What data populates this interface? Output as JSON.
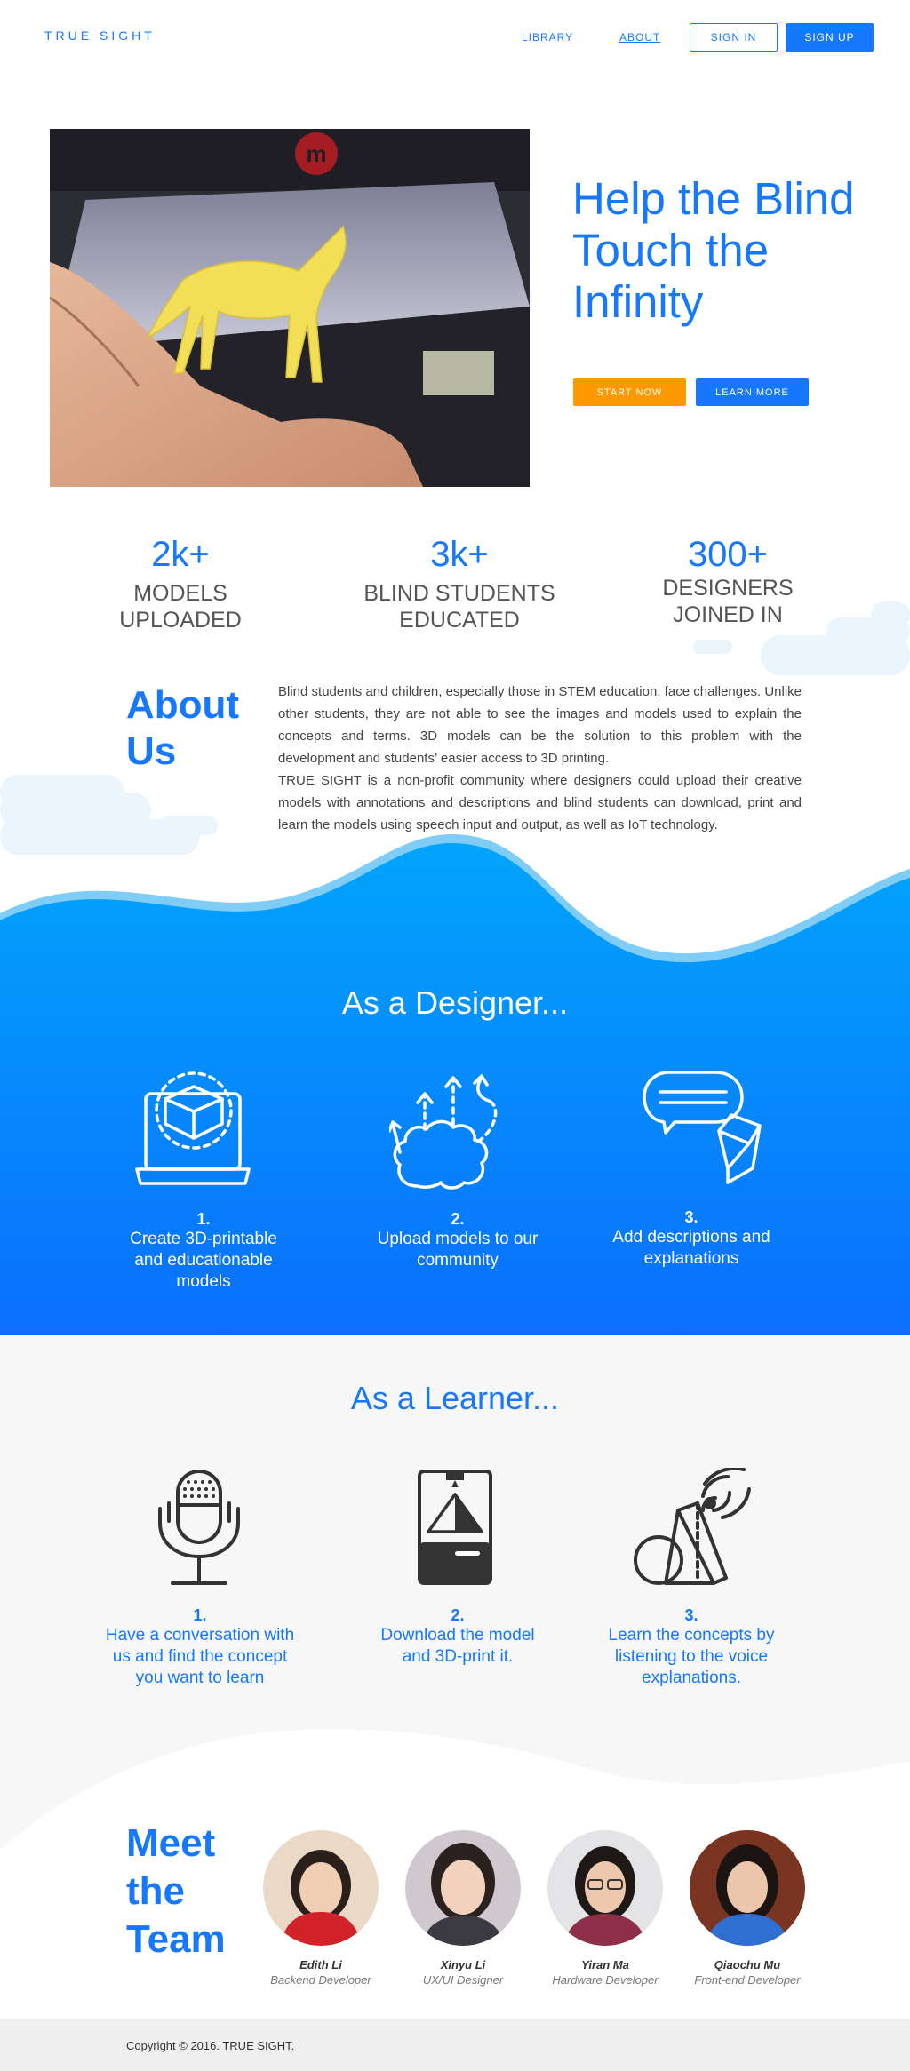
{
  "nav": {
    "brand": "TRUE SIGHT",
    "links": [
      "LIBRARY",
      "ABOUT"
    ],
    "sign_in": "SIGN IN",
    "sign_up": "SIGN UP"
  },
  "hero": {
    "title": "Help the Blind Touch the Infinity",
    "start_now": "START NOW",
    "learn_more": "LEARN MORE",
    "image": "3d-printed-horse-photo"
  },
  "stats": [
    {
      "number": "2k+",
      "label": "MODELS UPLOADED"
    },
    {
      "number": "3k+",
      "label": "BLIND STUDENTS EDUCATED"
    },
    {
      "number": "300+",
      "label": "DESIGNERS JOINED IN"
    }
  ],
  "about": {
    "title": "About Us",
    "paragraph1": "Blind students and children, especially those in STEM education, face challenges. Unlike other students, they are not able to see the images and models used to explain the concepts and terms. 3D models can be the solution to this problem with the development and students’ easier access to 3D printing.",
    "paragraph2": "TRUE SIGHT is a non-profit community where designers could upload their creative models with annotations and descriptions and blind students can download, print and learn the models using speech input and output, as well as IoT technology."
  },
  "designer": {
    "title": "As a Designer...",
    "steps": [
      {
        "num": "1.",
        "text": "Create 3D-printable and educationable models",
        "icon": "laptop-cube-icon"
      },
      {
        "num": "2.",
        "text": "Upload models to our community",
        "icon": "brain-upload-icon"
      },
      {
        "num": "3.",
        "text": "Add descriptions and explanations",
        "icon": "chat-cube-icon"
      }
    ]
  },
  "learner": {
    "title": "As a Learner...",
    "steps": [
      {
        "num": "1.",
        "text": "Have a conversation with us and find the concept you want to learn",
        "icon": "microphone-icon"
      },
      {
        "num": "2.",
        "text": "Download the model and 3D-print it.",
        "icon": "3d-printer-icon"
      },
      {
        "num": "3.",
        "text": "Learn the concepts by listening to the voice explanations.",
        "icon": "shapes-speaker-icon"
      }
    ]
  },
  "team": {
    "title": "Meet the Team",
    "members": [
      {
        "name": "Edith Li",
        "role": "Backend Developer"
      },
      {
        "name": "Xinyu Li",
        "role": "UX/UI Designer"
      },
      {
        "name": "Yiran Ma",
        "role": "Hardware Developer"
      },
      {
        "name": "Qiaochu Mu",
        "role": "Front-end Developer"
      }
    ]
  },
  "footer": {
    "copyright": "Copyright © 2016. TRUE SIGHT."
  },
  "colors": {
    "accent": "#1677ff",
    "orange": "#ff9900",
    "designer_gradient_top": "#02a2fb",
    "designer_gradient_bottom": "#0d6efd"
  }
}
